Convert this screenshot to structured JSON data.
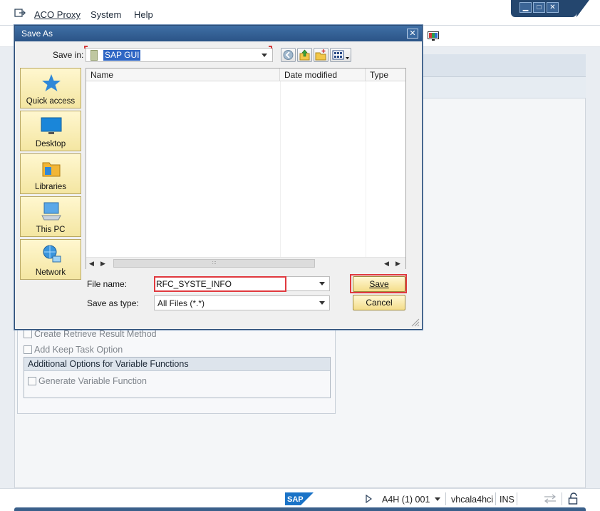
{
  "menubar": {
    "items": [
      {
        "label": "ACO Proxy",
        "underline_index": 0
      },
      {
        "label": "System",
        "underline_index": 0
      },
      {
        "label": "Help",
        "underline_index": 0
      }
    ]
  },
  "background_panel": {
    "options": [
      {
        "label": "Create Retrieve Result Method",
        "checked": false
      },
      {
        "label": "Add Keep Task Option",
        "checked": false
      }
    ],
    "subgroup_title": "Additional Options for Variable Functions",
    "subgroup_options": [
      {
        "label": "Generate Variable Function",
        "checked": false
      }
    ]
  },
  "statusbar": {
    "logo_text": "SAP",
    "system": "A4H (1) 001",
    "server": "vhcala4hci",
    "mode": "INS"
  },
  "dialog": {
    "title": "Save As",
    "close_glyph": "✕",
    "save_in_label": "Save in:",
    "save_in_value": "SAP GUI",
    "places": [
      {
        "label": "Quick access",
        "icon": "star-icon"
      },
      {
        "label": "Desktop",
        "icon": "desktop-icon"
      },
      {
        "label": "Libraries",
        "icon": "libraries-icon"
      },
      {
        "label": "This PC",
        "icon": "computer-icon"
      },
      {
        "label": "Network",
        "icon": "network-icon"
      }
    ],
    "columns": [
      "Name",
      "Date modified",
      "Type"
    ],
    "scroll_arrow_left": "◀",
    "scroll_arrow_right": "▶",
    "scroll_thumb_grip": ":::",
    "file_name_label": "File name:",
    "file_name_value": "RFC_SYSTE_INFO",
    "save_as_type_label": "Save as type:",
    "save_as_type_value": "All Files (*.*)",
    "save_button": "Save",
    "cancel_button": "Cancel"
  },
  "colors": {
    "highlight": "#e0393e",
    "title_bar": "#2b5487",
    "button_face": "#f4dd8a"
  }
}
